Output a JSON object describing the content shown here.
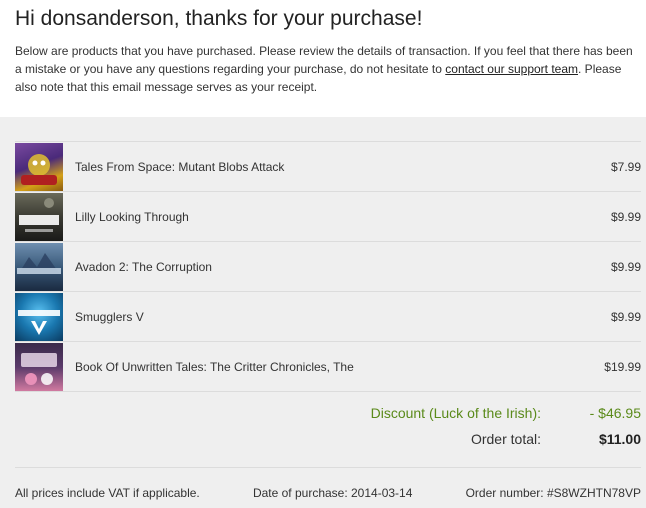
{
  "header": {
    "greeting": "Hi donsanderson, thanks for your purchase!",
    "intro_before_link": "Below are products that you have purchased. Please review the details of transaction. If you feel that there has been a mistake or you have any questions regarding your purchase, do not hesitate to ",
    "support_link": "contact our support team",
    "intro_after_link": ". Please also note that this email message serves as your receipt."
  },
  "items": [
    {
      "name": "Tales From Space: Mutant Blobs Attack",
      "price": "$7.99",
      "thumb_icon": "mutant-blobs-cover",
      "thumb_colors": [
        "#5a3a8a",
        "#d4a017"
      ]
    },
    {
      "name": "Lilly Looking Through",
      "price": "$9.99",
      "thumb_icon": "lilly-cover",
      "thumb_colors": [
        "#2a2a2a",
        "#7a7a6a"
      ]
    },
    {
      "name": "Avadon 2: The Corruption",
      "price": "$9.99",
      "thumb_icon": "avadon-cover",
      "thumb_colors": [
        "#1e3a5a",
        "#5f7f9f"
      ]
    },
    {
      "name": "Smugglers V",
      "price": "$9.99",
      "thumb_icon": "smugglers-cover",
      "thumb_colors": [
        "#0d5a8a",
        "#3aa0d0"
      ]
    },
    {
      "name": "Book Of Unwritten Tales: The Critter Chronicles, The",
      "price": "$19.99",
      "thumb_icon": "critter-chronicles-cover",
      "thumb_colors": [
        "#2a1a3a",
        "#c85a8a"
      ]
    }
  ],
  "totals": {
    "discount_label": "Discount (Luck of the Irish):",
    "discount_value": "- $46.95",
    "total_label": "Order total:",
    "total_value": "$11.00"
  },
  "footer": {
    "vat_note": "All prices include VAT if applicable.",
    "purchase_date": "Date of purchase: 2014-03-14",
    "order_number": "Order number: #S8WZHTN78VP"
  },
  "colors": {
    "panel_bg": "#efefef",
    "discount": "#5a8a1a",
    "divider": "#dcdcdc"
  }
}
